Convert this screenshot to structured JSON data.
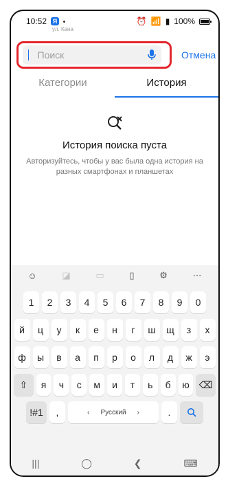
{
  "status": {
    "time": "10:52",
    "app_badge": "Я",
    "battery": "100%"
  },
  "map_hint": "ул. Кана",
  "search": {
    "placeholder": "Поиск",
    "cancel": "Отмена"
  },
  "tabs": [
    {
      "label": "Категории",
      "active": false
    },
    {
      "label": "История",
      "active": true
    }
  ],
  "empty_state": {
    "title": "История поиска пуста",
    "description": "Авторизуйтесь, чтобы у вас была одна история на разных смартфонах и планшетах"
  },
  "keyboard": {
    "numbers": [
      "1",
      "2",
      "3",
      "4",
      "5",
      "6",
      "7",
      "8",
      "9",
      "0"
    ],
    "row1": [
      "й",
      "ц",
      "у",
      "к",
      "е",
      "н",
      "г",
      "ш",
      "щ",
      "з",
      "х"
    ],
    "row2": [
      "ф",
      "ы",
      "в",
      "а",
      "п",
      "р",
      "о",
      "л",
      "д",
      "ж",
      "э"
    ],
    "row3": [
      "я",
      "ч",
      "с",
      "м",
      "и",
      "т",
      "ь",
      "б",
      "ю"
    ],
    "bottom": {
      "symbols": "!#1",
      "comma": ",",
      "space_label": "Русский",
      "period": "."
    }
  },
  "accent_color": "#1a73e8",
  "highlight_color": "#e3262c"
}
